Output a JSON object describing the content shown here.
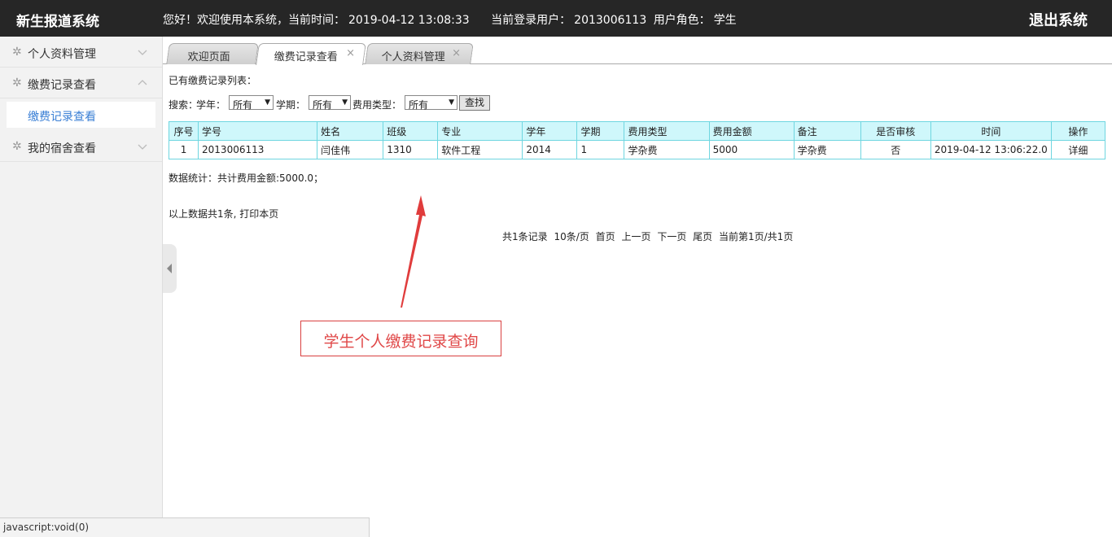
{
  "header": {
    "brand": "新生报道系统",
    "greeting": "您好！欢迎使用本系统，当前时间：",
    "current_time": "2019-04-12 13:08:33",
    "user_label": "当前登录用户：",
    "user_id": "2013006113",
    "role_label": "用户角色：",
    "role": "学生",
    "logout": "退出系统"
  },
  "sidebar": {
    "groups": [
      {
        "label": "个人资料管理"
      },
      {
        "label": "缴费记录查看",
        "expanded": true,
        "children": [
          "缴费记录查看"
        ]
      },
      {
        "label": "我的宿舍查看"
      }
    ]
  },
  "tabs": [
    {
      "label": "欢迎页面",
      "closable": false
    },
    {
      "label": "缴费记录查看",
      "closable": true,
      "active": true
    },
    {
      "label": "个人资料管理",
      "closable": true
    }
  ],
  "main": {
    "caption": "已有缴费记录列表：",
    "search": {
      "label": "搜索：",
      "year_label": "学年：",
      "year_value": "所有",
      "term_label": "学期：",
      "term_value": "所有",
      "type_label": "费用类型：",
      "type_value": "所有",
      "find_button": "查找"
    },
    "table": {
      "headers": [
        "序号",
        "学号",
        "姓名",
        "班级",
        "专业",
        "学年",
        "学期",
        "费用类型",
        "费用金额",
        "备注",
        "是否审核",
        "时间",
        "操作"
      ],
      "rows": [
        [
          "1",
          "2013006113",
          "闫佳伟",
          "1310",
          "软件工程",
          "2014",
          "1",
          "学杂费",
          "5000",
          "学杂费",
          "否",
          "2019-04-12 13:06:22.0",
          "详细"
        ]
      ]
    },
    "stats": "数据统计：共计费用金额:5000.0；",
    "total_text": "以上数据共1条, 打印本页",
    "pager": {
      "records": "共1条记录",
      "per_page": "10条/页",
      "first": "首页",
      "prev": "上一页",
      "next": "下一页",
      "last": "尾页",
      "current": "当前第1页/共1页"
    }
  },
  "annotation": {
    "text": "学生个人缴费记录查询",
    "color": "#e04848"
  },
  "statusbar": {
    "text": "javascript:void(0)"
  },
  "colors": {
    "topbar": "#262626",
    "table_header": "#cff7fb",
    "table_border": "#6fd6e0",
    "sidebar_link": "#3a7fd5"
  }
}
